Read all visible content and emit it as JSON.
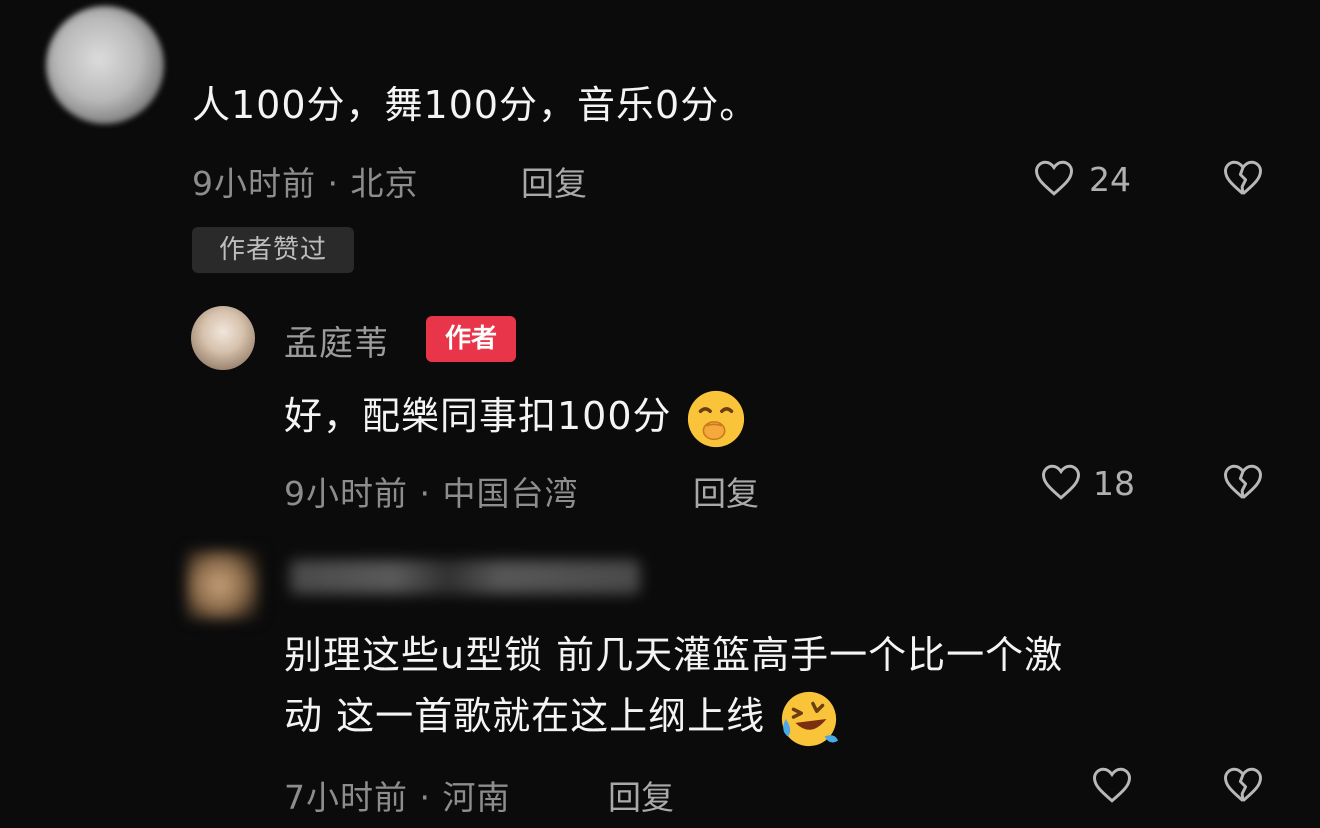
{
  "comment1": {
    "username": "",
    "text": "人100分，舞100分，音乐0分。",
    "time": "9小时前 · 北京",
    "reply_label": "回复",
    "likes": "24",
    "author_liked_tag": "作者赞过"
  },
  "comment2": {
    "username": "孟庭苇",
    "author_badge": "作者",
    "text": "好，配樂同事扣100分",
    "time": "9小时前 · 中国台湾",
    "reply_label": "回复",
    "likes": "18"
  },
  "comment3": {
    "username": "",
    "text_line1": "别理这些u型锁 前几天灌篮高手一个比一个激",
    "text_line2": "动 这一首歌就在这上纲上线",
    "time": "7小时前 · 河南",
    "reply_label": "回复"
  },
  "colors": {
    "background": "#0b0b0c",
    "author_badge": "#e8354a",
    "tag_bg": "#2a2a2a"
  },
  "icons": [
    "heart-icon",
    "broken-heart-icon",
    "emoji-giggle-icon",
    "emoji-laugh-cry-icon"
  ]
}
